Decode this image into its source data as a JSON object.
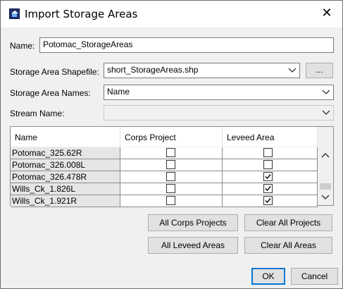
{
  "window": {
    "title": "Import Storage Areas",
    "close_glyph": "✕"
  },
  "form": {
    "name_label": "Name:",
    "name_value": "Potomac_StorageAreas",
    "shapefile_label": "Storage Area Shapefile:",
    "shapefile_value": "short_StorageAreas.shp",
    "browse_label": "...",
    "names_label": "Storage Area Names:",
    "names_value": "Name",
    "stream_label": "Stream Name:",
    "stream_value": ""
  },
  "table": {
    "columns": [
      "Name",
      "Corps Project",
      "Leveed Area"
    ],
    "rows": [
      {
        "name": "Potomac_325.62R",
        "corps": false,
        "leveed": false
      },
      {
        "name": "Potomac_326.008L",
        "corps": false,
        "leveed": false
      },
      {
        "name": "Potomac_326.478R",
        "corps": false,
        "leveed": true
      },
      {
        "name": "Wills_Ck_1.826L",
        "corps": false,
        "leveed": true
      },
      {
        "name": "Wills_Ck_1.921R",
        "corps": false,
        "leveed": true
      }
    ]
  },
  "buttons": {
    "all_corps": "All Corps Projects",
    "clear_projects": "Clear All Projects",
    "all_leveed": "All Leveed Areas",
    "clear_areas": "Clear All Areas",
    "ok": "OK",
    "cancel": "Cancel"
  },
  "icons": {
    "app": "storage-area-app-icon",
    "dropdown": "chevron-down-icon",
    "scroll_up": "chevron-up-icon",
    "scroll_down": "chevron-down-icon",
    "check": "checkmark-icon"
  }
}
